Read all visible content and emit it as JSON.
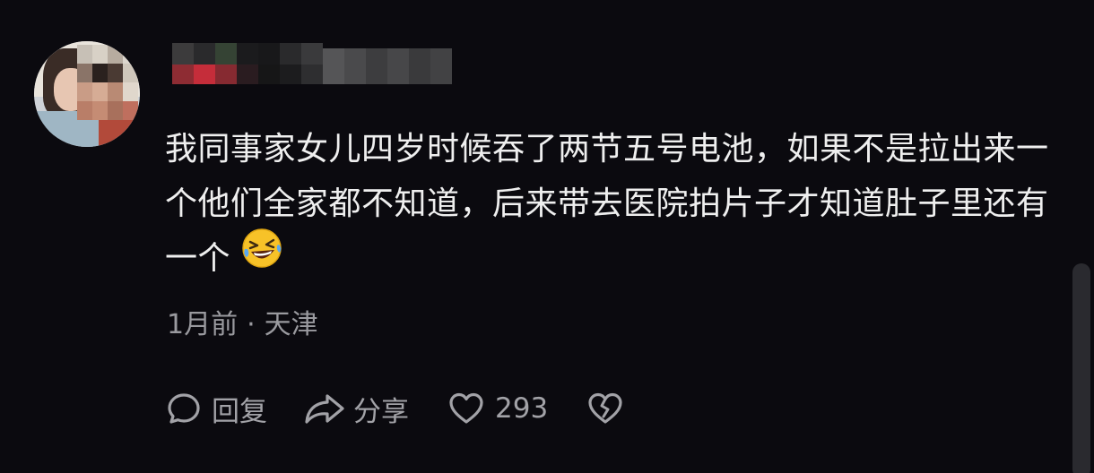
{
  "comment": {
    "avatar_icon": "user-avatar",
    "username_icon": "blurred-username",
    "text": "我同事家女儿四岁时候吞了两节五号电池，如果不是拉出来一个他们全家都不知道，后来带去医院拍片子才知道肚子里还有一个",
    "emoji": "rolling-on-the-floor-laughing",
    "time": "1月前",
    "separator": "·",
    "location": "天津",
    "actions": {
      "reply_label": "回复",
      "share_label": "分享",
      "like_count": "293",
      "reply_icon": "speech-bubble-icon",
      "share_icon": "share-arrow-icon",
      "like_icon": "heart-icon",
      "dislike_icon": "broken-heart-icon"
    }
  },
  "colors": {
    "background": "#0b0a0f",
    "text": "#efefef",
    "muted": "#9a9a9f",
    "emoji_face": "#f7c228"
  }
}
